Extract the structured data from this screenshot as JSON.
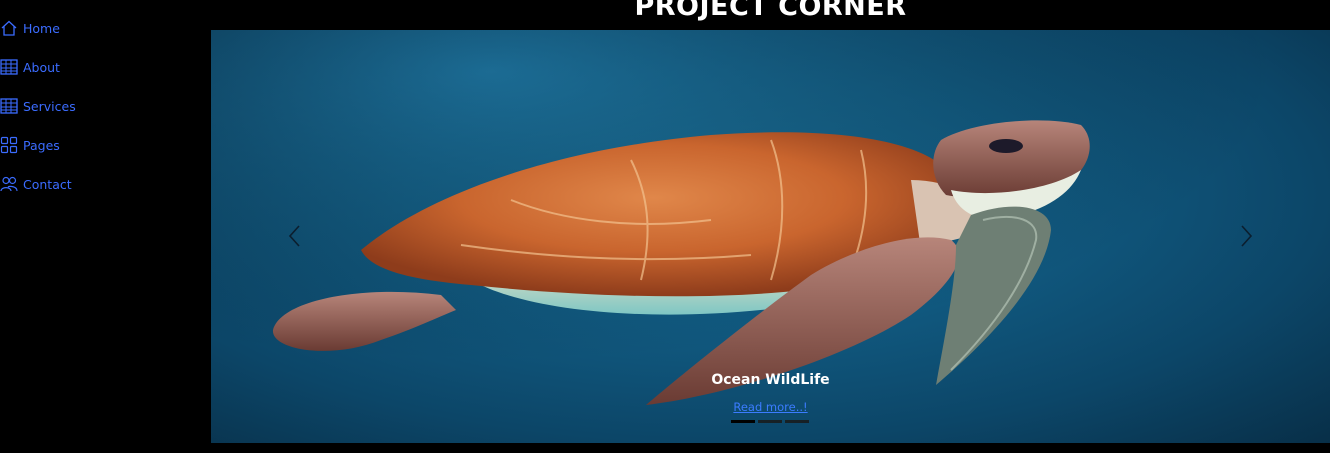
{
  "header": {
    "title": "PROJECT CORNER"
  },
  "sidebar": {
    "items": [
      {
        "label": "Home",
        "icon": "home-icon"
      },
      {
        "label": "About",
        "icon": "table-icon"
      },
      {
        "label": "Services",
        "icon": "table-icon"
      },
      {
        "label": "Pages",
        "icon": "grid-icon"
      },
      {
        "label": "Contact",
        "icon": "people-icon"
      }
    ]
  },
  "carousel": {
    "caption_title": "Ocean WildLife",
    "caption_link": "Read more..!",
    "slides_count": 3,
    "active_slide": 1
  },
  "colors": {
    "nav_text": "#3b6cff",
    "link": "#3b7cff",
    "background": "#000000",
    "ocean": "#115b82"
  }
}
